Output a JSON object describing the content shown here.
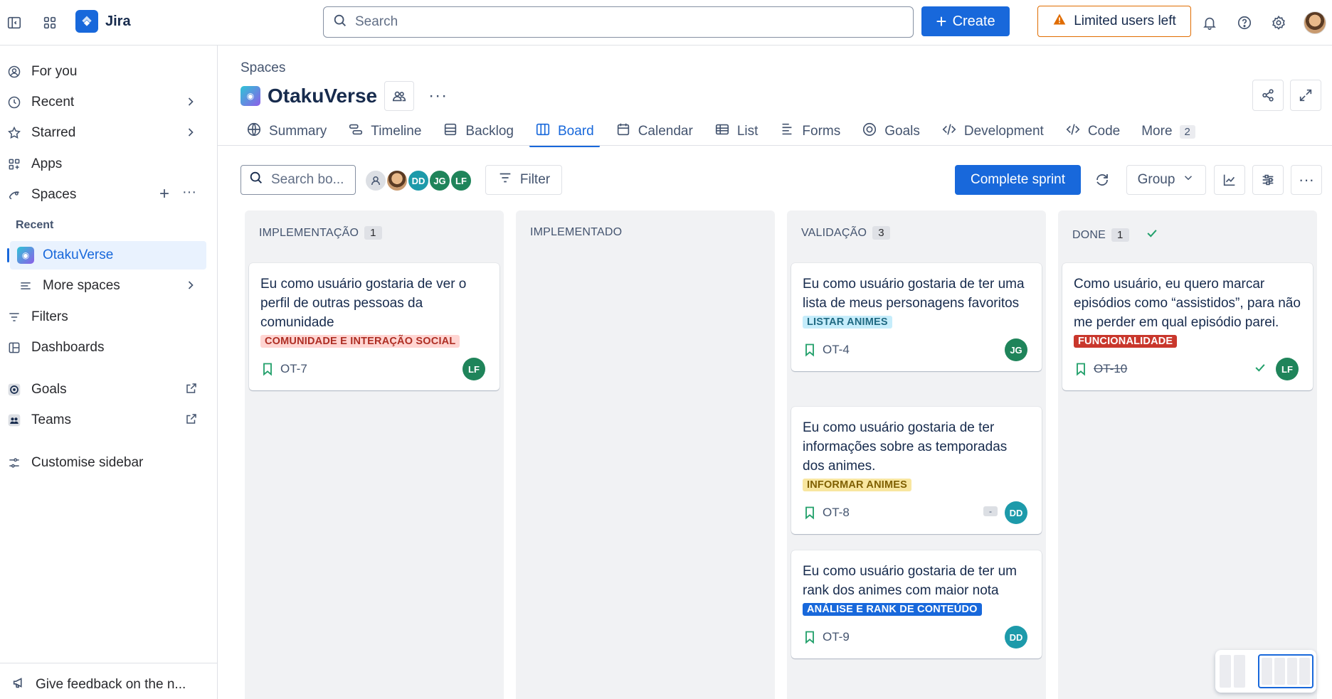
{
  "topbar": {
    "app_name": "Jira",
    "search_placeholder": "Search",
    "create_label": "Create",
    "limited_label": "Limited users left"
  },
  "sidebar": {
    "items": [
      {
        "label": "For you"
      },
      {
        "label": "Recent"
      },
      {
        "label": "Starred"
      },
      {
        "label": "Apps"
      },
      {
        "label": "Spaces"
      }
    ],
    "recent_heading": "Recent",
    "recent_space": "OtakuVerse",
    "more_spaces": "More spaces",
    "filters": "Filters",
    "dashboards": "Dashboards",
    "goals": "Goals",
    "teams": "Teams",
    "customise": "Customise sidebar",
    "feedback": "Give feedback on the n..."
  },
  "header": {
    "breadcrumb": "Spaces",
    "project_name": "OtakuVerse"
  },
  "tabs": [
    {
      "label": "Summary"
    },
    {
      "label": "Timeline"
    },
    {
      "label": "Backlog"
    },
    {
      "label": "Board",
      "active": true
    },
    {
      "label": "Calendar"
    },
    {
      "label": "List"
    },
    {
      "label": "Forms"
    },
    {
      "label": "Goals"
    },
    {
      "label": "Development"
    },
    {
      "label": "Code"
    },
    {
      "label": "More",
      "count": "2"
    }
  ],
  "toolbar": {
    "search_placeholder": "Search bo...",
    "avatars": [
      "DD",
      "JG",
      "LF"
    ],
    "filter_label": "Filter",
    "complete_sprint_label": "Complete sprint",
    "group_label": "Group"
  },
  "columns": [
    {
      "title": "IMPLEMENTAÇÃO",
      "count": "1",
      "cards": [
        {
          "title": "Eu como usuário gostaria de ver o perfil de outras pessoas da comunidade",
          "label": "COMUNIDADE E INTERAÇÃO SOCIAL",
          "key": "OT-7",
          "assignee": "LF"
        }
      ]
    },
    {
      "title": "IMPLEMENTADO",
      "count": "",
      "cards": []
    },
    {
      "title": "VALIDAÇÃO",
      "count": "3",
      "cards": [
        {
          "title": "Eu como usuário gostaria de ter uma lista de meus personagens favoritos",
          "label": "LISTAR ANIMES",
          "key": "OT-4",
          "assignee": "JG"
        },
        {
          "title": "Eu como usuário gostaria de ter informações sobre as temporadas dos animes.",
          "label": "INFORMAR ANIMES",
          "key": "OT-8",
          "assignee": "DD",
          "badge": "-"
        },
        {
          "title": "Eu como usuário gostaria de ter um rank dos animes com maior nota",
          "label": "ANÁLISE E RANK DE CONTEÚDO",
          "key": "OT-9",
          "assignee": "DD"
        }
      ]
    },
    {
      "title": "DONE",
      "count": "1",
      "cards": [
        {
          "title": "Como usuário, eu quero marcar episódios como “assistidos”, para não me perder em qual episódio parei.",
          "label": "FUNCIONALIDADE",
          "key": "OT-10",
          "assignee": "LF"
        }
      ]
    }
  ],
  "colors": {
    "accent": "#1868db",
    "lf": "#1f845a",
    "jg": "#1f845a",
    "dd": "#1d9aaa",
    "label_social_bg": "#ffd5d2",
    "label_social_fg": "#ae2e24",
    "label_listar_bg": "#c6edfb",
    "label_listar_fg": "#206a83",
    "label_informar_bg": "#f8e6a0",
    "label_informar_fg": "#7f5f01",
    "label_analise_bg": "#1868db",
    "label_funcionalidade_bg": "#c9372c"
  }
}
